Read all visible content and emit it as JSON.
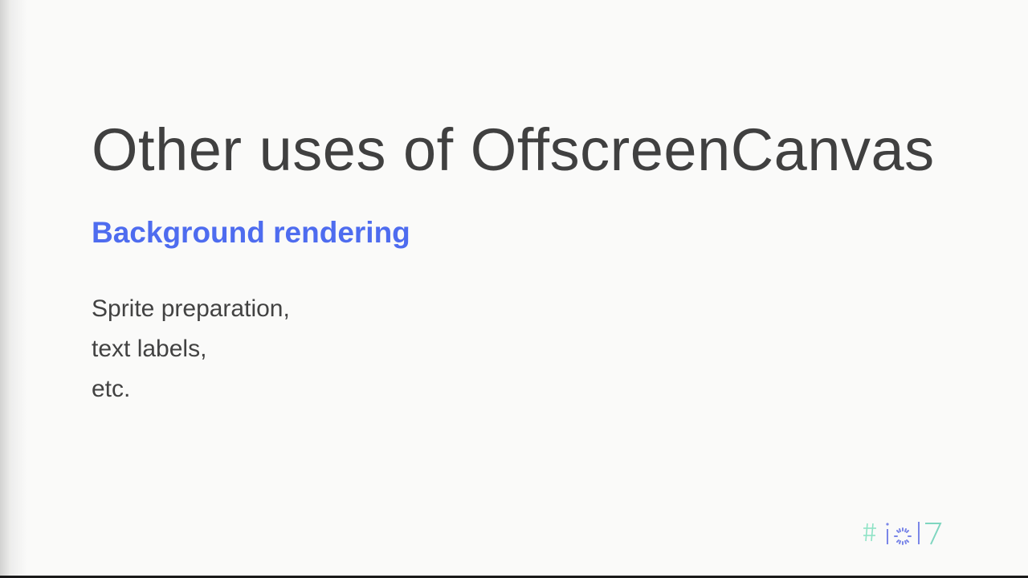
{
  "slide": {
    "title": "Other uses of OffscreenCanvas",
    "subtitle": "Background rendering",
    "body_lines": [
      "Sprite preparation,",
      "text labels,",
      "etc."
    ]
  },
  "logo": {
    "name": "io17-logo"
  },
  "colors": {
    "background": "#fafaf9",
    "title": "#404040",
    "subtitle": "#4e6cef",
    "body": "#424242",
    "logo_hash": "#8fe3c6",
    "logo_letters": "#7a86e8",
    "logo_seven": "#7fd6c0"
  }
}
